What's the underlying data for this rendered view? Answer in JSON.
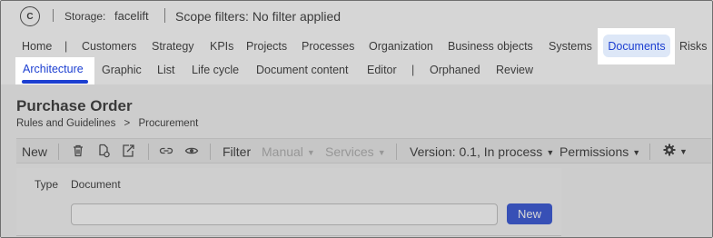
{
  "topbar": {
    "logo_letter": "C",
    "storage_label": "Storage:",
    "storage_value": "facelift",
    "scope_text": "Scope filters: No filter applied"
  },
  "nav_main": {
    "items": [
      "Home",
      "Customers",
      "Strategy",
      "KPIs",
      "Projects",
      "Processes",
      "Organization",
      "Business objects",
      "Systems",
      "Documents",
      "Risks"
    ],
    "active": "Documents"
  },
  "nav_sub": {
    "items": [
      "Architecture",
      "Graphic",
      "List",
      "Life cycle",
      "Document content",
      "Editor",
      "Orphaned",
      "Review"
    ],
    "active": "Architecture"
  },
  "page": {
    "title": "Purchase Order",
    "breadcrumb": [
      "Rules and Guidelines",
      ">",
      "Procurement"
    ]
  },
  "toolbar": {
    "new_label": "New",
    "filter_label": "Filter",
    "manual_label": "Manual",
    "services_label": "Services",
    "version_label": "Version: 0.1, In process",
    "permissions_label": "Permissions"
  },
  "form": {
    "type_label": "Type",
    "type_value": "Document",
    "name_placeholder": "",
    "new_button": "New"
  },
  "colors": {
    "accent": "#1c3fd1",
    "active_pill_bg": "#dde7f7"
  }
}
